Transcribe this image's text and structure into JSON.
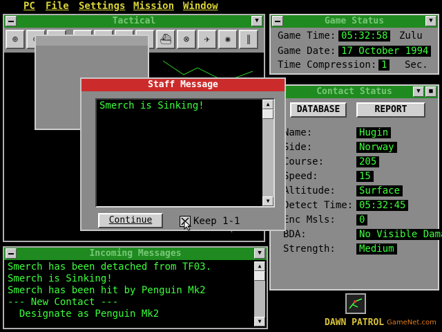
{
  "menu": [
    "PC",
    "File",
    "Settings",
    "Mission",
    "Window"
  ],
  "tactical": {
    "title": "Tactical",
    "toolbar_icons": [
      "zoom-in-icon",
      "zoom-out-icon",
      "menu-icon",
      "radar-icon",
      "db-icon",
      "binoculars-icon",
      "bearing-icon",
      "ship-icon",
      "target-icon",
      "aircraft-icon",
      "sonar-icon",
      "bars-icon"
    ]
  },
  "game_status": {
    "title": "Game Status",
    "time_label": "Game Time:",
    "time_value": "05:32:58",
    "time_zone": "Zulu",
    "date_label": "Game Date:",
    "date_value": "17 October 1994",
    "compression_label": "Time Compression:",
    "compression_value": "1",
    "compression_unit": "Sec."
  },
  "contact_status": {
    "title": "Contact Status",
    "database_button": "DATABASE",
    "report_button": "REPORT",
    "fields": [
      {
        "label": "Name:",
        "value": "Hugin"
      },
      {
        "label": "Side:",
        "value": "Norway"
      },
      {
        "label": "Course:",
        "value": "205"
      },
      {
        "label": "Speed:",
        "value": "15"
      },
      {
        "label": "Altitude:",
        "value": "Surface"
      },
      {
        "label": "Detect Time:",
        "value": "05:32:45"
      },
      {
        "label": "Enc Msls:",
        "value": "0"
      },
      {
        "label": "BDA:",
        "value": "No Visible Damage"
      },
      {
        "label": "Strength:",
        "value": "Medium"
      }
    ]
  },
  "staff_message": {
    "title": "Staff Message",
    "text": "Smerch is Sinking!",
    "continue_button": "Continue",
    "keep_label": "Keep 1-1"
  },
  "incoming": {
    "title": "Incoming Messages",
    "lines": [
      "Smerch has been detached from TF03.",
      "Smerch is Sinking!",
      "Smerch has been hit by Penguin Mk2",
      "--- New Contact ---",
      "  Designate as Penguin Mk2"
    ]
  },
  "logo_text": "DAWN PATROL",
  "watermark": "GameNet.com",
  "colors": {
    "title_green": "#1f8a1f",
    "dialog_red": "#cc2b2b",
    "value_green": "#3cff3c"
  }
}
